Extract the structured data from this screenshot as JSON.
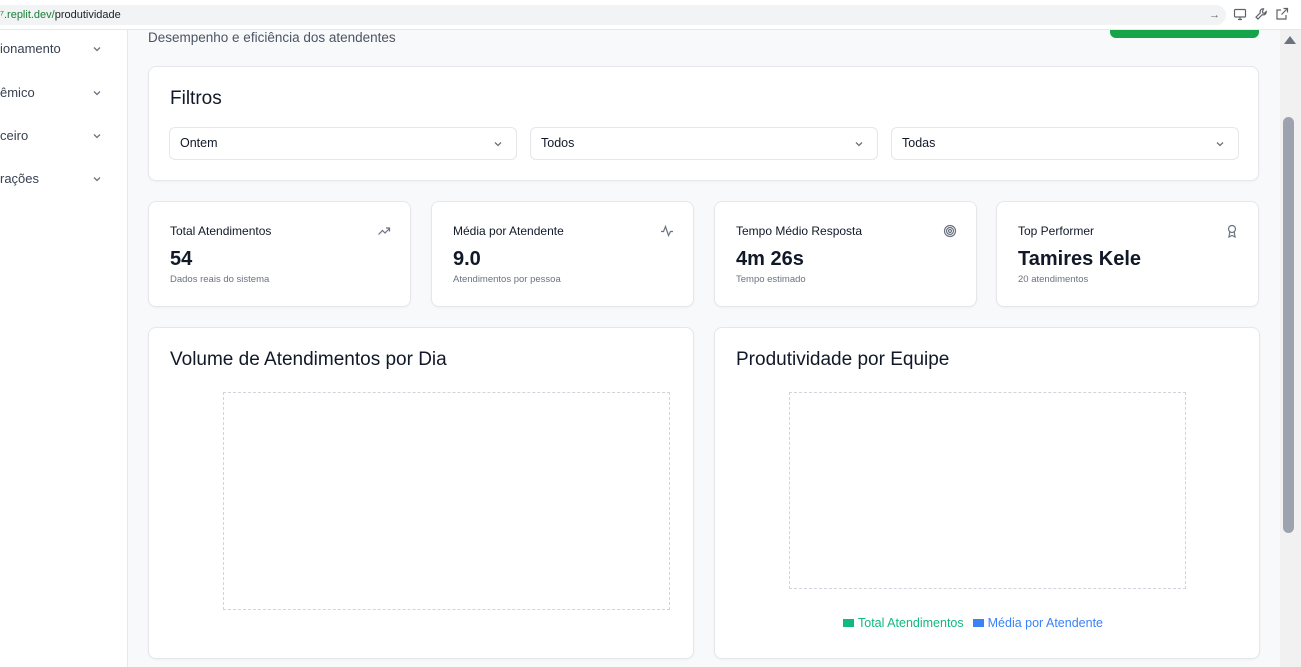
{
  "browser": {
    "url_host": "⁷.replit.dev/",
    "url_path": "produtividade"
  },
  "sidebar": {
    "items": [
      {
        "label": "ionamento"
      },
      {
        "label": "êmico"
      },
      {
        "label": "ceiro"
      },
      {
        "label": "rações"
      }
    ]
  },
  "page": {
    "subtitle": "Desempenho e eficiência dos atendentes"
  },
  "filters": {
    "title": "Filtros",
    "selects": [
      {
        "value": "Ontem"
      },
      {
        "value": "Todos"
      },
      {
        "value": "Todas"
      }
    ]
  },
  "stats": [
    {
      "label": "Total Atendimentos",
      "value": "54",
      "sub": "Dados reais do sistema",
      "icon": "trending-up-icon"
    },
    {
      "label": "Média por Atendente",
      "value": "9.0",
      "sub": "Atendimentos por pessoa",
      "icon": "activity-icon"
    },
    {
      "label": "Tempo Médio Resposta",
      "value": "4m 26s",
      "sub": "Tempo estimado",
      "icon": "target-icon"
    },
    {
      "label": "Top Performer",
      "value": "Tamires Kele",
      "sub": "20 atendimentos",
      "icon": "award-icon"
    }
  ],
  "charts": {
    "volume_title": "Volume de Atendimentos por Dia",
    "team_title": "Produtividade por Equipe",
    "legend": [
      {
        "label": "Total Atendimentos",
        "color": "#10b981"
      },
      {
        "label": "Média por Atendente",
        "color": "#3b82f6"
      }
    ]
  }
}
